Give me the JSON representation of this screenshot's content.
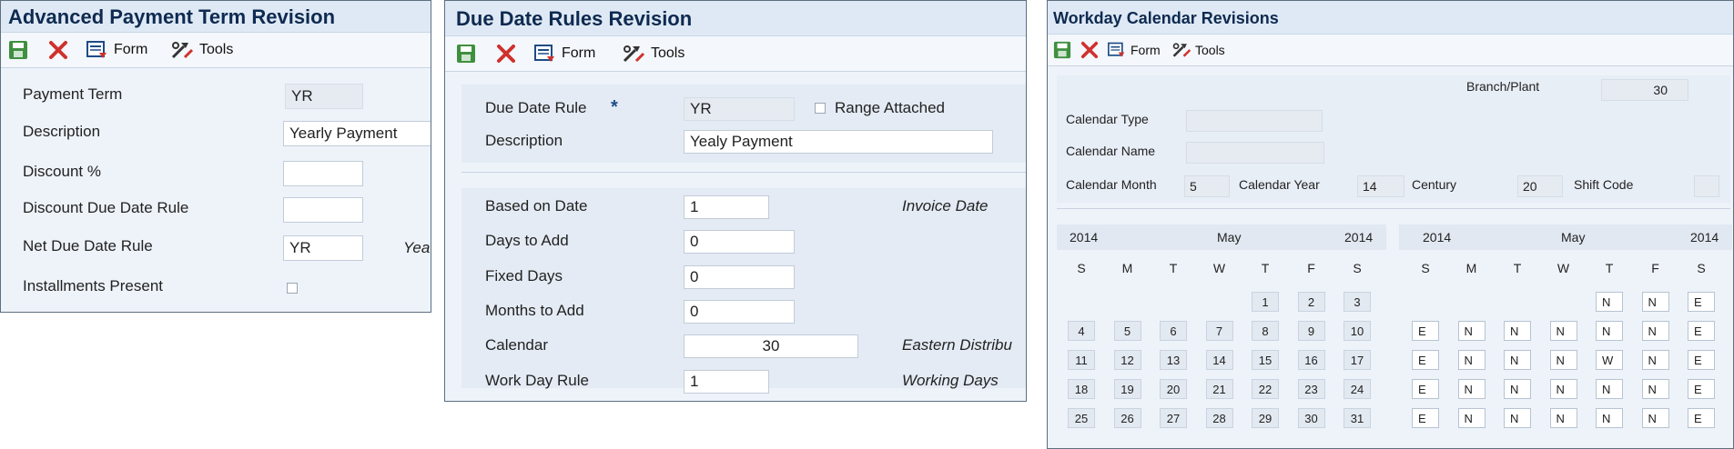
{
  "panel1": {
    "title": "Advanced Payment Term Revision",
    "toolbar": {
      "form": "Form",
      "tools": "Tools"
    },
    "fields": [
      {
        "label": "Payment Term",
        "value": "YR",
        "readonly": true
      },
      {
        "label": "Description",
        "value": "Yearly Payment"
      },
      {
        "label": "Discount %",
        "value": ""
      },
      {
        "label": "Discount Due Date Rule",
        "value": ""
      },
      {
        "label": "Net Due Date Rule",
        "value": "YR",
        "hint": "Yea"
      },
      {
        "label": "Installments Present",
        "checkbox": true
      }
    ]
  },
  "panel2": {
    "title": "Due Date Rules Revision",
    "toolbar": {
      "form": "Form",
      "tools": "Tools"
    },
    "due_date_rule": {
      "label": "Due Date Rule",
      "required": "*",
      "value": "YR",
      "range_label": "Range Attached"
    },
    "description": {
      "label": "Description",
      "value": "Yealy Payment"
    },
    "rows": [
      {
        "label": "Based on Date",
        "value": "1",
        "hint": "Invoice Date"
      },
      {
        "label": "Days to Add",
        "value": "0"
      },
      {
        "label": "Fixed Days",
        "value": "0"
      },
      {
        "label": "Months to Add",
        "value": "0"
      },
      {
        "label": "Calendar",
        "value": "30",
        "hint": "Eastern Distribu"
      },
      {
        "label": "Work Day Rule",
        "value": "1",
        "hint": "Working Days"
      }
    ]
  },
  "panel3": {
    "title": "Workday Calendar Revisions",
    "toolbar": {
      "form": "Form",
      "tools": "Tools"
    },
    "branch_plant": {
      "label": "Branch/Plant",
      "value": "30"
    },
    "calendar_type": {
      "label": "Calendar Type",
      "value": ""
    },
    "calendar_name": {
      "label": "Calendar Name",
      "value": ""
    },
    "calendar_month": {
      "label": "Calendar Month",
      "value": "5"
    },
    "calendar_year": {
      "label": "Calendar Year",
      "value": "14"
    },
    "century": {
      "label": "Century",
      "value": "20"
    },
    "shift_code": {
      "label": "Shift Code",
      "value": ""
    },
    "left_cal": {
      "year": "2014",
      "month": "May",
      "days_of_week": [
        "S",
        "M",
        "T",
        "W",
        "T",
        "F",
        "S"
      ],
      "weeks": [
        [
          "",
          "",
          "",
          "",
          "1",
          "2",
          "3"
        ],
        [
          "4",
          "5",
          "6",
          "7",
          "8",
          "9",
          "10"
        ],
        [
          "11",
          "12",
          "13",
          "14",
          "15",
          "16",
          "17"
        ],
        [
          "18",
          "19",
          "20",
          "21",
          "22",
          "23",
          "24"
        ],
        [
          "25",
          "26",
          "27",
          "28",
          "29",
          "30",
          "31"
        ]
      ]
    },
    "right_cal": {
      "year": "2014",
      "month": "May",
      "days_of_week": [
        "S",
        "M",
        "T",
        "W",
        "T",
        "F",
        "S"
      ],
      "weeks": [
        [
          "",
          "",
          "",
          "",
          "N",
          "N",
          "E"
        ],
        [
          "E",
          "N",
          "N",
          "N",
          "N",
          "N",
          "E"
        ],
        [
          "E",
          "N",
          "N",
          "N",
          "W",
          "N",
          "E"
        ],
        [
          "E",
          "N",
          "N",
          "N",
          "N",
          "N",
          "E"
        ],
        [
          "E",
          "N",
          "N",
          "N",
          "N",
          "N",
          "E"
        ]
      ]
    }
  },
  "icons": [
    "save-icon",
    "delete-icon",
    "form-icon",
    "tools-icon"
  ],
  "colors": {
    "title_text": "#0e2a50",
    "delete_red": "#d0312d",
    "save_green": "#3f8f3f"
  }
}
